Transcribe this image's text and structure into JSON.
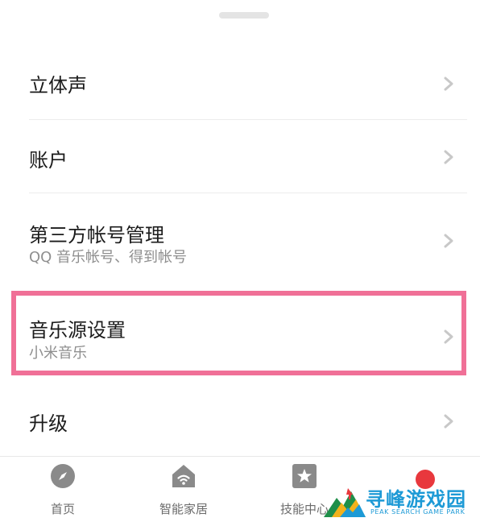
{
  "settings": {
    "items": [
      {
        "title": "立体声",
        "subtitle": ""
      },
      {
        "title": "账户",
        "subtitle": ""
      },
      {
        "title": "第三方帐号管理",
        "subtitle": "QQ 音乐帐号、得到帐号"
      },
      {
        "title": "音乐源设置",
        "subtitle": "小米音乐"
      },
      {
        "title": "升级",
        "subtitle": ""
      }
    ]
  },
  "bottom_nav": {
    "items": [
      {
        "label": "首页",
        "icon": "compass-icon"
      },
      {
        "label": "智能家居",
        "icon": "smart-home-icon"
      },
      {
        "label": "技能中心",
        "icon": "star-skill-icon"
      },
      {
        "label": "",
        "icon": "profile-icon"
      }
    ]
  },
  "watermark": {
    "text_cn": "寻峰游戏园",
    "text_en": "PEAK SEARCH GAME PARK"
  },
  "colors": {
    "highlight": "#f07097",
    "chevron": "#c8c8c8",
    "nav_icon": "#8a8a8a",
    "profile_icon": "#e8383d",
    "watermark": "#1d9ad6"
  }
}
